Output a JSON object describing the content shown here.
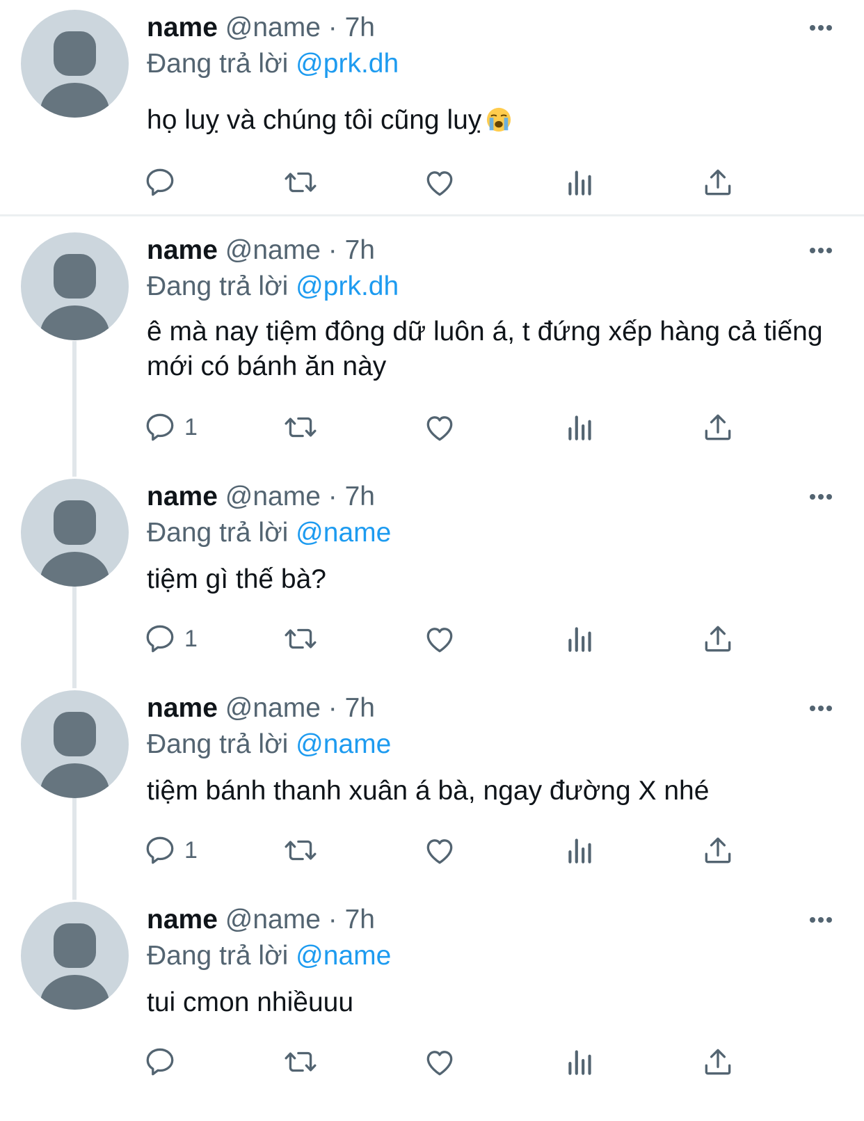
{
  "colors": {
    "accent": "#1d9bf0",
    "secondary_text": "#536471",
    "primary_text": "#0f1419",
    "avatar_bg": "#ccd6dd",
    "avatar_fg": "#66757f",
    "thread_line": "#e1e6ea"
  },
  "icons": [
    "more-icon",
    "reply-icon",
    "retweet-icon",
    "like-icon",
    "views-icon",
    "share-icon",
    "loudly-crying-face-emoji"
  ],
  "tweets": [
    {
      "name": "name",
      "handle": "@name",
      "dot": "·",
      "time": "7h",
      "replying_prefix": "Đang trả lời",
      "replying_to": "@prk.dh",
      "text": "họ luỵ và chúng tôi cũng luỵ",
      "emoji": "loudly-crying-face",
      "reply_count": ""
    },
    {
      "name": "name",
      "handle": "@name",
      "dot": "·",
      "time": "7h",
      "replying_prefix": "Đang trả lời",
      "replying_to": "@prk.dh",
      "text": "ê mà nay tiệm đông dữ luôn á, t đứng xếp hàng cả tiếng mới có bánh ăn này",
      "reply_count": "1"
    },
    {
      "name": "name",
      "handle": "@name",
      "dot": "·",
      "time": "7h",
      "replying_prefix": "Đang trả lời",
      "replying_to": "@name",
      "text": "tiệm gì thế bà?",
      "reply_count": "1"
    },
    {
      "name": "name",
      "handle": "@name",
      "dot": "·",
      "time": "7h",
      "replying_prefix": "Đang trả lời",
      "replying_to": "@name",
      "text": "tiệm bánh thanh xuân á bà, ngay đường X nhé",
      "reply_count": "1"
    },
    {
      "name": "name",
      "handle": "@name",
      "dot": "·",
      "time": "7h",
      "replying_prefix": "Đang trả lời",
      "replying_to": "@name",
      "text": "tui cmon nhiềuuu",
      "reply_count": ""
    }
  ]
}
